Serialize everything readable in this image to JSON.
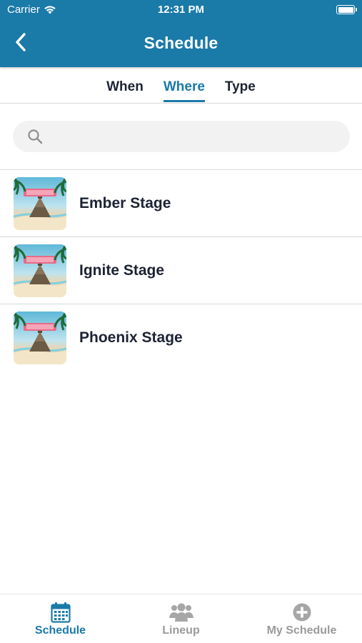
{
  "status_bar": {
    "carrier": "Carrier",
    "time": "12:31 PM"
  },
  "nav": {
    "title": "Schedule",
    "back_icon": "chevron-left-icon"
  },
  "tabs": [
    {
      "label": "When",
      "active": false
    },
    {
      "label": "Where",
      "active": true
    },
    {
      "label": "Type",
      "active": false
    }
  ],
  "search": {
    "placeholder": "",
    "value": "",
    "icon": "search-icon"
  },
  "stages": [
    {
      "name": "Ember Stage"
    },
    {
      "name": "Ignite Stage"
    },
    {
      "name": "Phoenix Stage"
    }
  ],
  "tabbar": [
    {
      "label": "Schedule",
      "icon": "calendar-icon",
      "active": true
    },
    {
      "label": "Lineup",
      "icon": "group-icon",
      "active": false
    },
    {
      "label": "My Schedule",
      "icon": "plus-circle-icon",
      "active": false
    }
  ],
  "colors": {
    "primary": "#1a7aa8",
    "text": "#1c2333",
    "inactive": "#9a9a9a"
  }
}
